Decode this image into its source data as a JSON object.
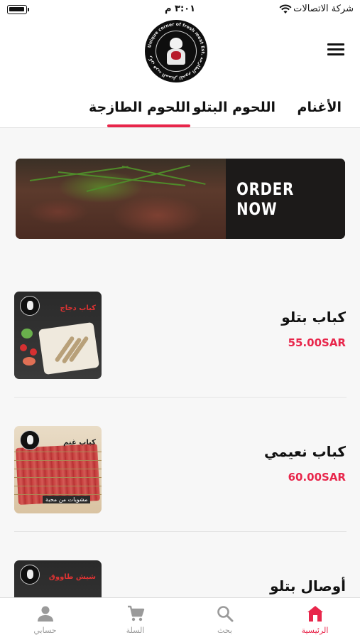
{
  "status_bar": {
    "carrier": "شركة الاتصالات",
    "time": "٣:٠١ م"
  },
  "header": {
    "logo_text": "Unique corner of fresh meat Est. ركن فريد الممتاز للحوم الطازجة",
    "menu_icon": "hamburger-menu-icon"
  },
  "tabs": [
    {
      "label": "الأغنام",
      "active": false
    },
    {
      "label": "اللحوم البتلو",
      "active": false
    },
    {
      "label": "اللحوم الطازجة",
      "active": true
    }
  ],
  "banner": {
    "cta": "ORDER NOW"
  },
  "products": [
    {
      "name": "كباب بتلو",
      "price": "55.00SAR",
      "image_title": "كباب دجاج"
    },
    {
      "name": "كباب نعيمي",
      "price": "60.00SAR",
      "image_title": "كباب غنم",
      "image_label": "مشويات من محبة"
    },
    {
      "name": "أوصال بتلو",
      "price": "",
      "image_title": "شيش طاووق"
    }
  ],
  "bottom_nav": [
    {
      "label": "الرئيسية",
      "icon": "home-icon",
      "active": true
    },
    {
      "label": "بحث",
      "icon": "search-icon",
      "active": false
    },
    {
      "label": "السلة",
      "icon": "cart-icon",
      "active": false
    },
    {
      "label": "حسابي",
      "icon": "account-icon",
      "active": false
    }
  ],
  "colors": {
    "accent": "#e8264b",
    "inactive": "#9a9a9a",
    "text": "#111111",
    "background": "#f7f7f7"
  }
}
